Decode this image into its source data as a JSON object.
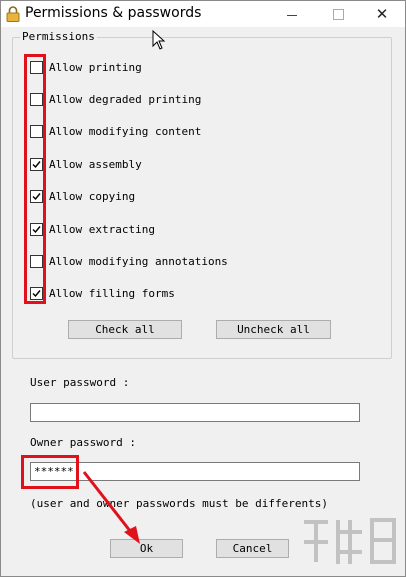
{
  "window": {
    "title": "Permissions & passwords",
    "icon": "lock-icon",
    "controls": [
      "minimize",
      "maximize",
      "close"
    ]
  },
  "permissions": {
    "legend": "Permissions",
    "items": [
      {
        "label": "Allow printing",
        "checked": false
      },
      {
        "label": "Allow degraded printing",
        "checked": false
      },
      {
        "label": "Allow modifying content",
        "checked": false
      },
      {
        "label": "Allow assembly",
        "checked": true
      },
      {
        "label": "Allow copying",
        "checked": true
      },
      {
        "label": "Allow extracting",
        "checked": true
      },
      {
        "label": "Allow modifying annotations",
        "checked": false
      },
      {
        "label": "Allow filling forms",
        "checked": true
      }
    ],
    "check_all_label": "Check all",
    "uncheck_all_label": "Uncheck all"
  },
  "user_password": {
    "label": "User password :",
    "value": ""
  },
  "owner_password": {
    "label": "Owner password :",
    "value": "******"
  },
  "note": "(user and owner passwords must be differents)",
  "buttons": {
    "ok_label": "Ok",
    "cancel_label": "Cancel"
  },
  "accent_color": "#e0111b"
}
